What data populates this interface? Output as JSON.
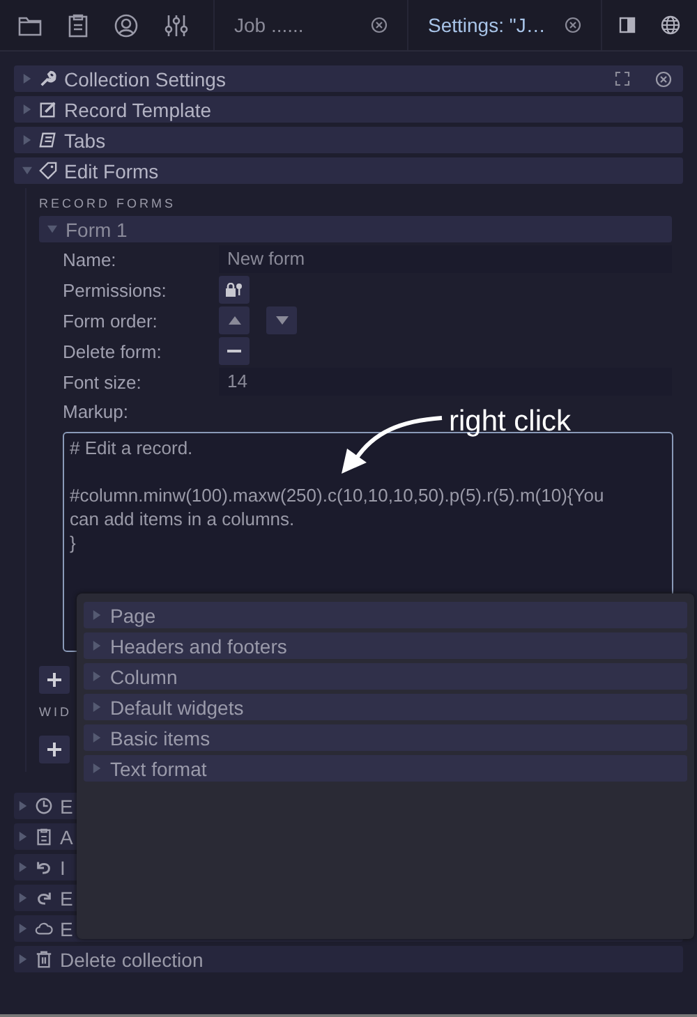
{
  "tabs": [
    {
      "label": "Job ......",
      "selected": false
    },
    {
      "label": "Settings: \"J…",
      "selected": true
    }
  ],
  "sections_top": [
    {
      "label": "Collection Settings",
      "expanded": false
    },
    {
      "label": "Record Template",
      "expanded": false
    },
    {
      "label": "Tabs",
      "expanded": false
    },
    {
      "label": "Edit Forms",
      "expanded": true
    }
  ],
  "record_forms": {
    "heading": "RECORD FORMS",
    "form": {
      "label": "Form 1",
      "expanded": true,
      "fields": [
        {
          "kind": "text",
          "label": "Name:",
          "value": "New form"
        },
        {
          "kind": "permissions",
          "label": "Permissions:"
        },
        {
          "kind": "order",
          "label": "Form order:"
        },
        {
          "kind": "delete",
          "label": "Delete form:"
        },
        {
          "kind": "text",
          "label": "Font size:",
          "value": "14"
        }
      ],
      "markup": {
        "label": "Markup:",
        "value": "# Edit a record.\n\n#column.minw(100).maxw(250).c(10,10,10,50).p(5).r(5).m(10){You\ncan add items in a columns.\n}"
      }
    }
  },
  "widgets_heading": "WID",
  "sections_bottom": [
    {
      "label": "E",
      "expanded": false
    },
    {
      "label": "A",
      "expanded": false
    },
    {
      "label": "I",
      "expanded": false
    },
    {
      "label": "E",
      "expanded": false
    },
    {
      "label": "E",
      "expanded": false
    },
    {
      "label": "Delete collection",
      "expanded": false
    }
  ],
  "context_menu": {
    "items": [
      {
        "label": "Page",
        "expanded": false
      },
      {
        "label": "Headers and footers",
        "expanded": false
      },
      {
        "label": "Column",
        "expanded": false
      },
      {
        "label": "Default widgets",
        "expanded": false
      },
      {
        "label": "Basic items",
        "expanded": false
      },
      {
        "label": "Text format",
        "expanded": false
      }
    ]
  },
  "annotation": {
    "label": "right click"
  }
}
